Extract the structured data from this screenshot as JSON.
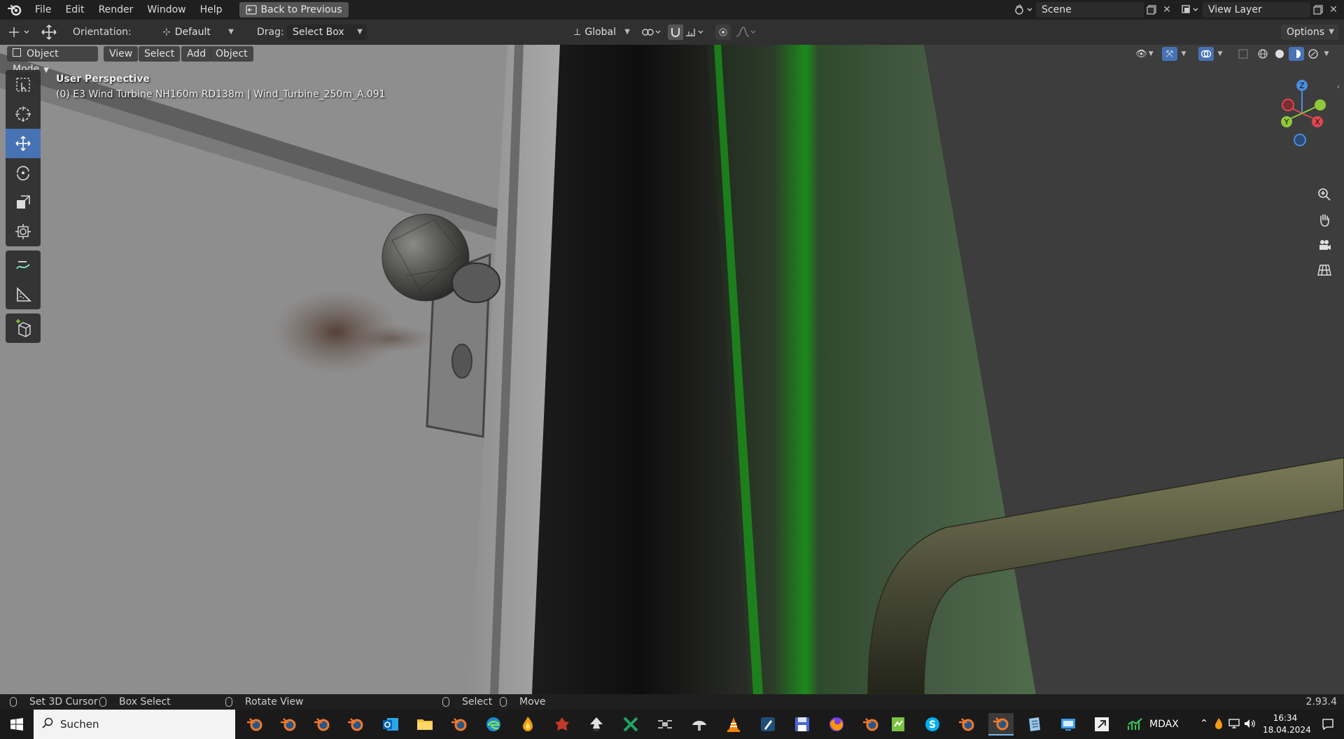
{
  "menu": {
    "items": [
      "File",
      "Edit",
      "Render",
      "Window",
      "Help"
    ],
    "back_button": "Back to Previous"
  },
  "scene": {
    "name": "Scene",
    "view_layer": "View Layer"
  },
  "tool_header": {
    "orientation_label": "Orientation:",
    "orientation_value": "Default",
    "drag_label": "Drag:",
    "drag_value": "Select Box",
    "transform_orientation": "Global",
    "options": "Options"
  },
  "viewport_header": {
    "mode": "Object Mode",
    "menus": [
      "View",
      "Select",
      "Add",
      "Object"
    ]
  },
  "viewport": {
    "perspective": "User Perspective",
    "object_info": "(0) E3 Wind Turbine NH160m RD138m | Wind_Turbine_250m_A.091"
  },
  "gizmo": {
    "x": "X",
    "y": "Y",
    "z": "Z"
  },
  "statusbar": {
    "set_cursor": "Set 3D Cursor",
    "box_select": "Box Select",
    "rotate_view": "Rotate View",
    "select": "Select",
    "move": "Move",
    "version": "2.93.4"
  },
  "taskbar": {
    "search_placeholder": "Suchen",
    "stock_label": "MDAX",
    "time": "16:34",
    "date": "18.04.2024"
  },
  "colors": {
    "accent": "#4772b3",
    "axis_x": "#e0474f",
    "axis_y": "#8fc93a",
    "axis_z": "#4a8fdd"
  }
}
